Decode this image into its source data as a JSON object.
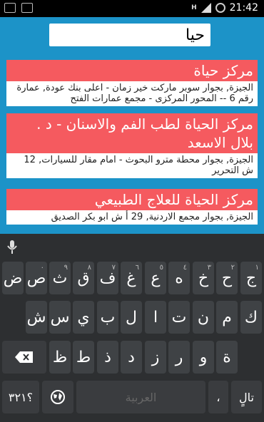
{
  "status_bar": {
    "left_icons": [
      "image-icon",
      "keyboard-icon"
    ],
    "network_label": "H",
    "time": "21:42"
  },
  "search": {
    "value": "حيا"
  },
  "results": [
    {
      "title": "مركز حياة",
      "address": "الجيزة, بجوار سوبر ماركت خير زمان - اعلى بنك عودة, عمارة رقم 6 -- المحور المركزى - مجمع عمارات الفتح"
    },
    {
      "title": "مركز الحياة لطب الفم والاسنان - د . بلال الاسعد",
      "address": "الجيزة, بجوار محطة مترو البحوث - امام مقار للسيارات, 12 ش التحرير"
    },
    {
      "title": "مركز الحياة للعلاج الطبيعي",
      "address": "الجيزة, بجوار مجمع الاردنية, 29 أ ش ابو بكر الصديق"
    }
  ],
  "keyboard": {
    "row1": [
      {
        "char": "ج",
        "hint": "١"
      },
      {
        "char": "ح",
        "hint": "٢"
      },
      {
        "char": "خ",
        "hint": "٣"
      },
      {
        "char": "ه",
        "hint": "٤"
      },
      {
        "char": "ع",
        "hint": "٥"
      },
      {
        "char": "غ",
        "hint": "٦"
      },
      {
        "char": "ف",
        "hint": "٧"
      },
      {
        "char": "ق",
        "hint": "٨"
      },
      {
        "char": "ث",
        "hint": "٩"
      },
      {
        "char": "ص",
        "hint": "٠"
      },
      {
        "char": "ض",
        "hint": ""
      }
    ],
    "row2": [
      "ك",
      "م",
      "ن",
      "ت",
      "ا",
      "ل",
      "ب",
      "ي",
      "س",
      "ش"
    ],
    "row3": [
      "ة",
      "و",
      "ر",
      "ز",
      "د",
      "ذ",
      "ط",
      "ظ"
    ],
    "symbols_key": "؟٣٢١",
    "space_label": "العربية",
    "next_key": "تالٍ",
    "comma_key": "،"
  }
}
